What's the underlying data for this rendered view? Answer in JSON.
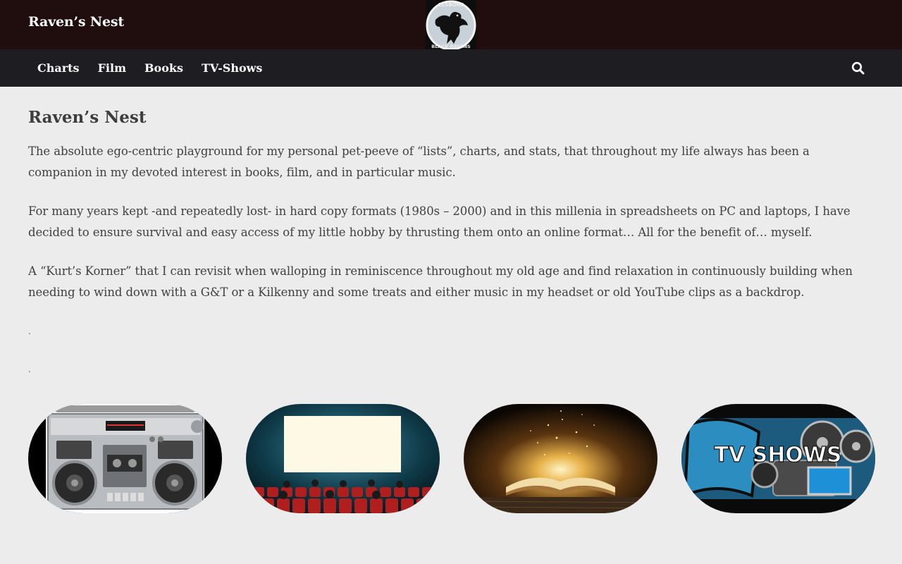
{
  "header": {
    "site_title": "Raven’s Nest",
    "logo": {
      "icon": "raven-logo",
      "top_text": "ELSBORE",
      "bottom_text": "BLACK RAVENS"
    }
  },
  "nav": {
    "items": [
      {
        "label": "Charts"
      },
      {
        "label": "Film"
      },
      {
        "label": "Books"
      },
      {
        "label": "TV-Shows"
      }
    ],
    "search_icon": "search-icon"
  },
  "main": {
    "title": "Raven’s Nest",
    "paragraphs": [
      "The absolute ego-centric playground for my personal pet-peeve of “lists”, charts, and stats, that throughout my life always has been a companion in my devoted interest in books, film, and in particular music.",
      "For many years kept -and repeatedly lost- in hard copy formats (1980s – 2000) and in this millenia in spreadsheets on PC and laptops, I have decided to ensure survival and easy access of my little hobby by thrusting them onto an online format… All for the benefit of… myself.",
      "A “Kurt’s Korner” that I can revisit when walloping in reminiscence throughout my old age and find relaxation in continuously building when needing to wind down with a G&T or a Kilkenny and some treats and either music in my headset or old YouTube clips as a backdrop."
    ],
    "dots": [
      ".",
      "."
    ]
  },
  "tiles": [
    {
      "name": "charts-tile",
      "image": "boombox"
    },
    {
      "name": "film-tile",
      "image": "cinema-screen"
    },
    {
      "name": "books-tile",
      "image": "glowing-book"
    },
    {
      "name": "tv-shows-tile",
      "image": "film-reel-camera",
      "text": "TV SHOWS"
    }
  ],
  "colors": {
    "header_bg": "#200d0d",
    "nav_bg": "#1d1d22",
    "page_bg": "#ececec",
    "text": "#404040"
  }
}
